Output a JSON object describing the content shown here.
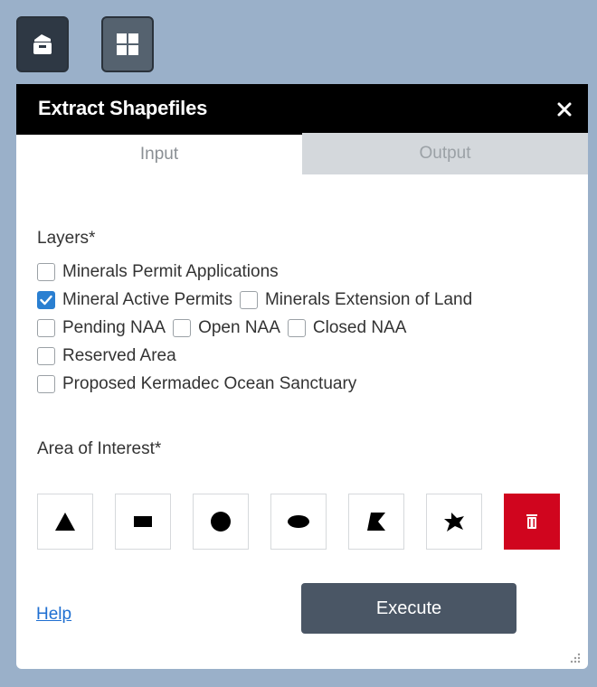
{
  "toolbar": {
    "toolbox_icon": "briefcase-icon",
    "grid_icon": "grid-icon"
  },
  "panel": {
    "title": "Extract Shapefiles",
    "close_glyph": "✕"
  },
  "tabs": [
    {
      "label": "Input",
      "active": true
    },
    {
      "label": "Output",
      "active": false
    }
  ],
  "layers": {
    "label": "Layers*",
    "rows": [
      [
        {
          "label": "Minerals Permit Applications",
          "checked": false
        }
      ],
      [
        {
          "label": "Mineral Active Permits",
          "checked": true
        },
        {
          "label": "Minerals Extension of Land",
          "checked": false
        }
      ],
      [
        {
          "label": "Pending NAA",
          "checked": false
        },
        {
          "label": "Open NAA",
          "checked": false
        },
        {
          "label": "Closed NAA",
          "checked": false
        }
      ],
      [
        {
          "label": "Reserved Area",
          "checked": false
        }
      ],
      [
        {
          "label": "Proposed Kermadec Ocean Sanctuary",
          "checked": false
        }
      ]
    ]
  },
  "aoi": {
    "label": "Area of Interest*",
    "tools": [
      "point-tool",
      "rectangle-tool",
      "circle-tool",
      "ellipse-tool",
      "polygon-tool",
      "freehand-polygon-tool",
      "delete-tool"
    ]
  },
  "footer": {
    "help": "Help",
    "execute": "Execute"
  },
  "colors": {
    "accent": "#2a7fd1",
    "delete": "#d0051e",
    "execute": "#4a5665"
  }
}
